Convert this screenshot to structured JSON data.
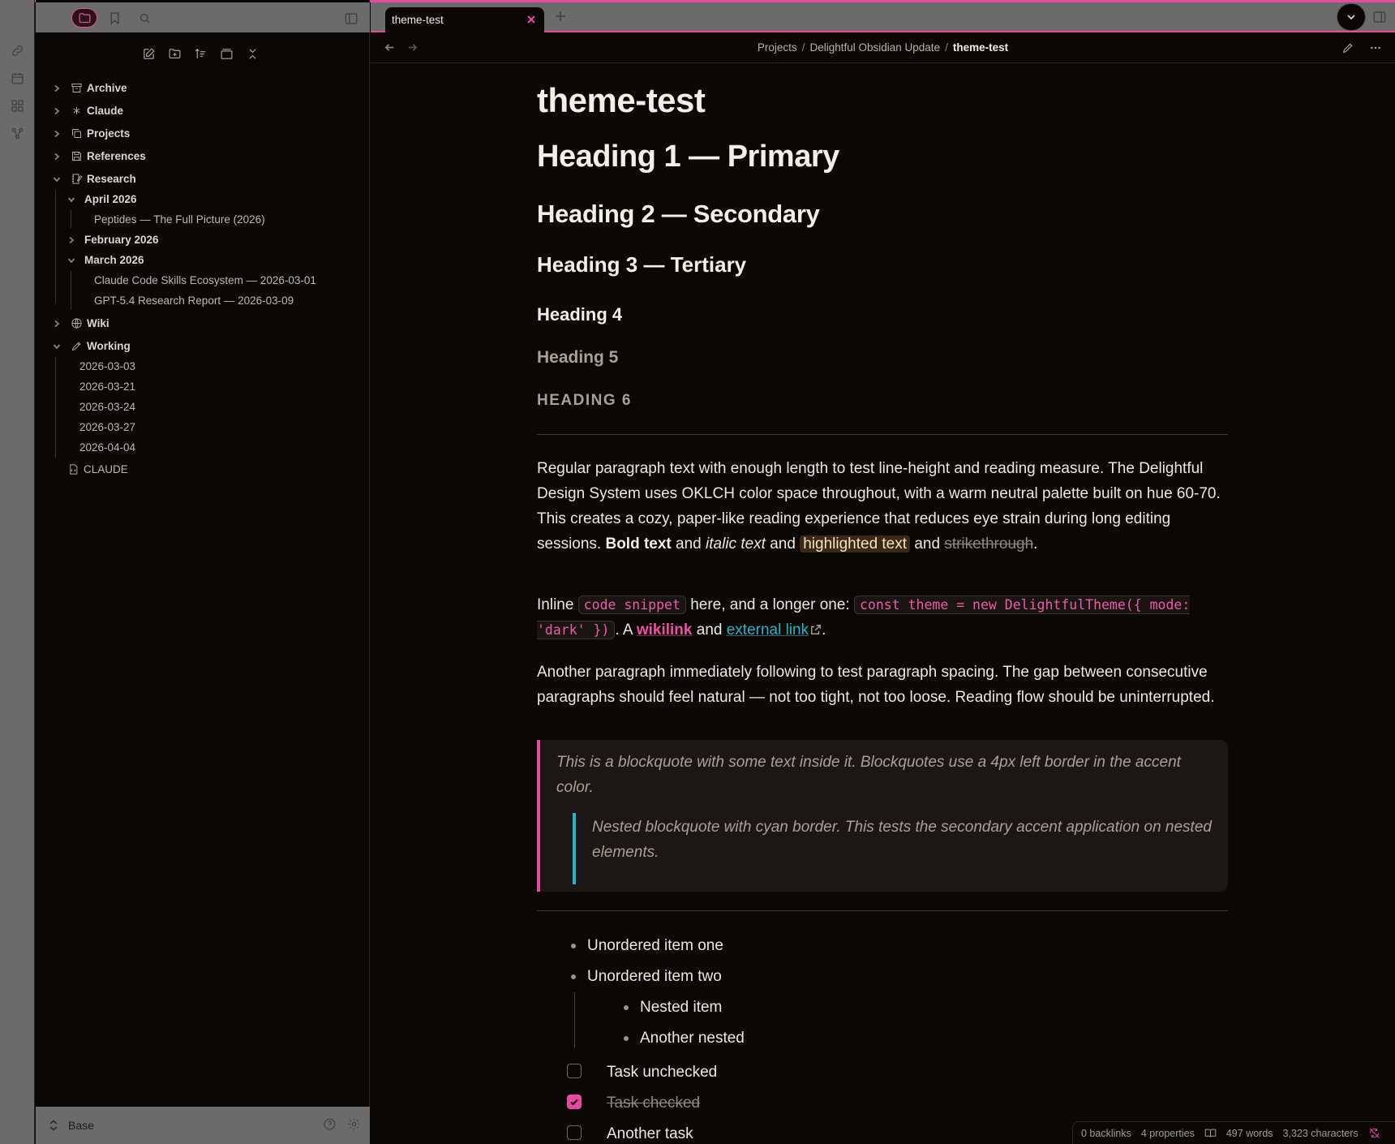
{
  "colors": {
    "accent": "#e74ba0",
    "secondary_accent": "#23b4cc",
    "background": "#0b0705",
    "chrome": "#6b6b6b"
  },
  "ribbon": {
    "icons": [
      "link-icon",
      "calendar-icon",
      "grid-icon",
      "graph-icon"
    ]
  },
  "sidebar": {
    "tabs": [
      "folder-icon",
      "bookmark-icon",
      "search-icon"
    ],
    "vault_name": "Base",
    "tree": {
      "archive": "Archive",
      "claude": "Claude",
      "projects": "Projects",
      "references": "References",
      "research": "Research",
      "april_2026": "April 2026",
      "peptides": "Peptides — The Full Picture (2026)",
      "february_2026": "February 2026",
      "march_2026": "March 2026",
      "claude_code_skills": "Claude Code Skills Ecosystem — 2026-03-01",
      "gpt54": "GPT-5.4 Research Report — 2026-03-09",
      "wiki": "Wiki",
      "working": "Working",
      "w1": "2026-03-03",
      "w2": "2026-03-21",
      "w3": "2026-03-24",
      "w4": "2026-03-27",
      "w5": "2026-04-04",
      "claude_file": "CLAUDE"
    }
  },
  "tab": {
    "title": "theme-test"
  },
  "breadcrumb": {
    "part1": "Projects",
    "part2": "Delightful Obsidian Update",
    "current": "theme-test",
    "sep": "/"
  },
  "doc": {
    "title": "theme-test",
    "h1": "Heading 1 — Primary",
    "h2": "Heading 2 — Secondary",
    "h3": "Heading 3 — Tertiary",
    "h4": "Heading 4",
    "h5": "Heading 5",
    "h6": "Heading 6",
    "p1_text": "Regular paragraph text with enough length to test line-height and reading measure. The Delightful Design System uses OKLCH color space throughout, with a warm neutral palette built on hue 60-70. This creates a cozy, paper-like reading experience that reduces eye strain during long editing sessions.",
    "p1_bold": "Bold text",
    "p1_and1": "and",
    "p1_italic": "italic text",
    "p1_and2": "and",
    "p1_highlight": "highlighted text",
    "p1_and3": "and",
    "p1_strike": "strikethrough",
    "p2_inline": "Inline",
    "p2_code1": "code snippet",
    "p2_mid": "here, and a longer one:",
    "p2_code2": "const theme = new DelightfulTheme({ mode: 'dark' })",
    "p2_a": ". A",
    "p2_wikilink": "wikilink",
    "p2_and": "and",
    "p2_extlink": "external link",
    "p3": "Another paragraph immediately following to test paragraph spacing. The gap between consecutive paragraphs should feel natural — not too tight, not too loose. Reading flow should be uninterrupted.",
    "quote": "This is a blockquote with some text inside it. Blockquotes use a 4px left border in the accent color.",
    "nested_quote": "Nested blockquote with cyan border. This tests the secondary accent application on nested elements.",
    "list1": "Unordered item one",
    "list2": "Unordered item two",
    "nested1": "Nested item",
    "nested2": "Another nested",
    "task1": {
      "label": "Task unchecked",
      "checked": false
    },
    "task2": {
      "label": "Task checked",
      "checked": true
    },
    "task3": {
      "label": "Another task",
      "checked": false
    }
  },
  "status": {
    "backlinks": "0 backlinks",
    "properties": "4 properties",
    "words": "497 words",
    "characters": "3,323 characters"
  }
}
